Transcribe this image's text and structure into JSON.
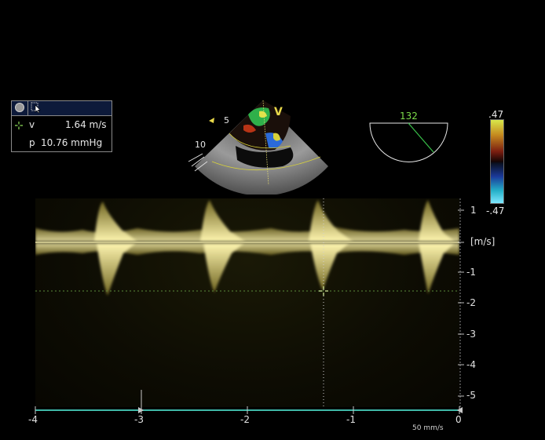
{
  "measurement": {
    "v_label": "v",
    "v_value": "1.64 m/s",
    "p_label": "p",
    "p_value": "10.76 mmHg"
  },
  "sector": {
    "depth_5": "5",
    "depth_10": "10",
    "marker": "V"
  },
  "angle_indicator": {
    "value": "132"
  },
  "color_scale": {
    "top": ".47",
    "bottom": "-.47"
  },
  "velocity_axis": {
    "unit": "[m/s]",
    "ticks": [
      "1",
      "-1",
      "-2",
      "-3",
      "-4",
      "-5"
    ]
  },
  "time_axis": {
    "ticks": [
      "-4",
      "-3",
      "-2",
      "-1",
      "0"
    ],
    "sweep_speed": "50 mm/s"
  },
  "colors": {
    "doppler_signal": "#f4e86a",
    "baseline": "#c9c28a",
    "time_axis": "#3fb8a8",
    "angle_line": "#39c24a"
  },
  "icons": [
    "record-icon",
    "cursor-select-icon",
    "crosshair-icon",
    "angle-semicircle-icon"
  ]
}
